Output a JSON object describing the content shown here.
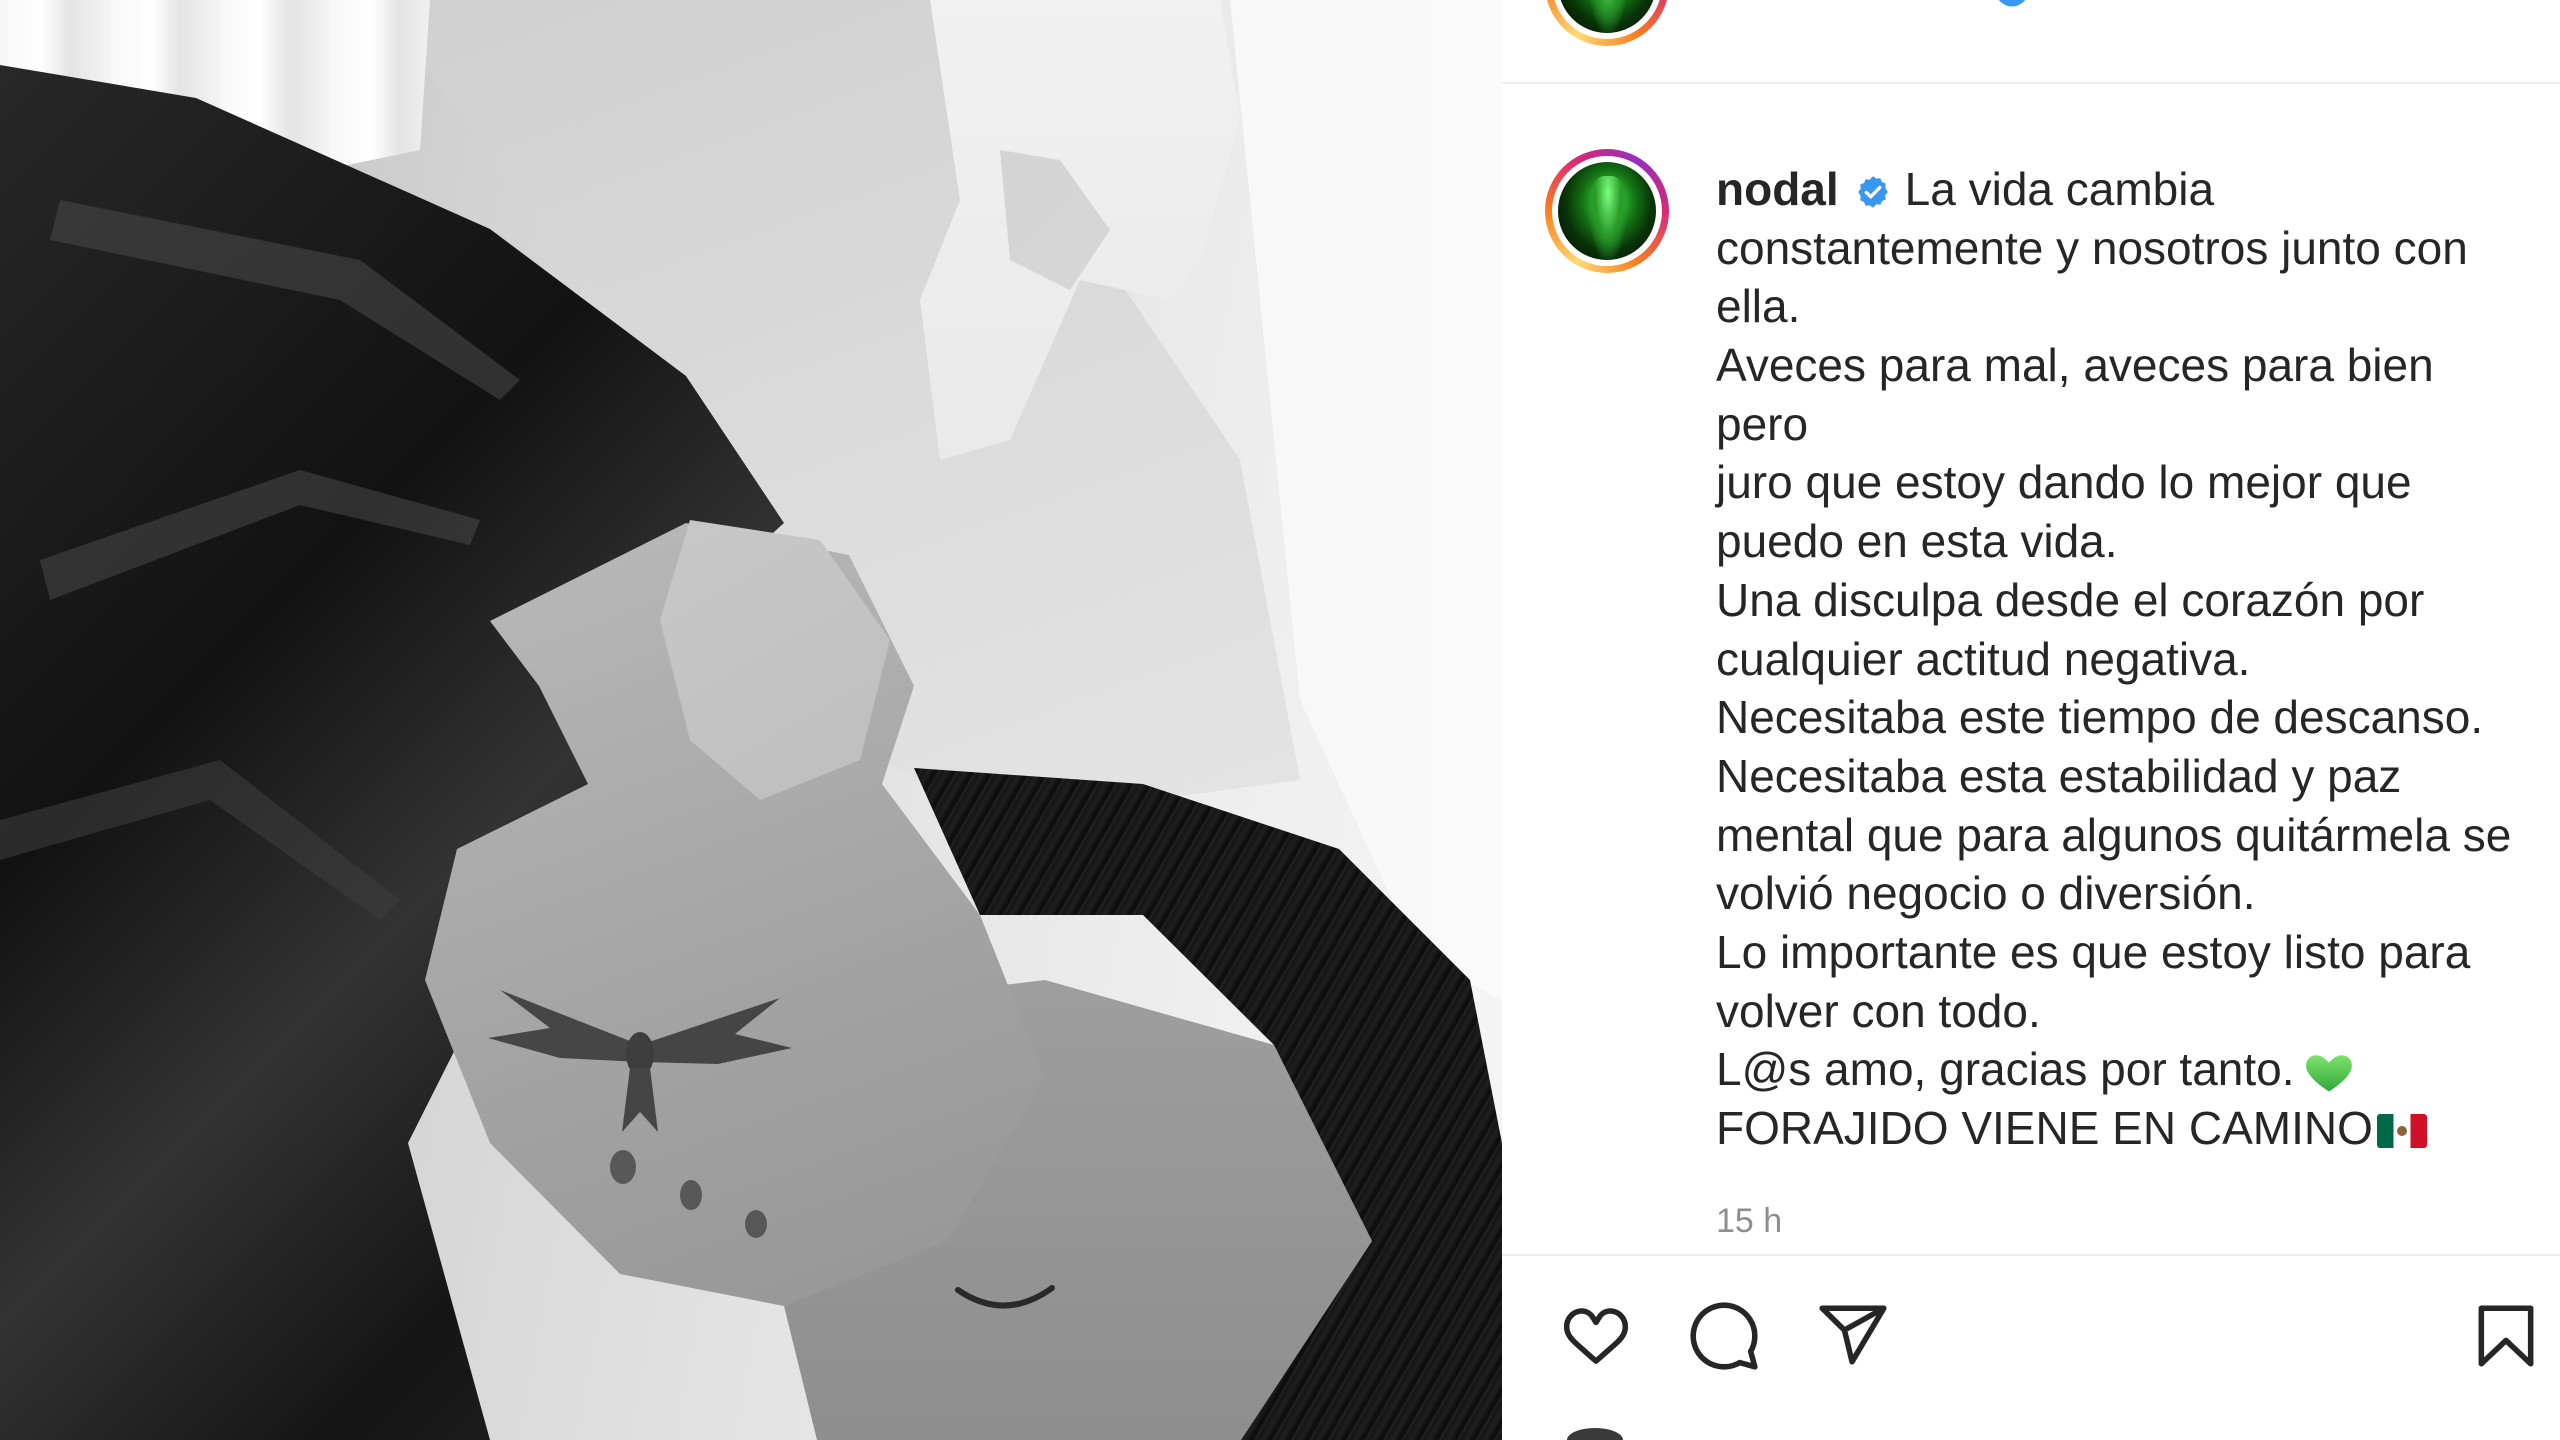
{
  "header": {
    "avatar_icon": "profile-avatar",
    "verified_icon": "verified-badge-icon"
  },
  "caption": {
    "username": "nodal",
    "verified_icon": "verified-badge-icon",
    "first_line": "La vida cambia",
    "lines": [
      "constantemente y nosotros junto con",
      "ella.",
      "Aveces para mal, aveces para bien",
      "pero",
      "juro que estoy dando lo mejor que",
      "puedo en esta vida.",
      "Una disculpa desde el corazón por",
      "cualquier actitud negativa.",
      "Necesitaba este tiempo de descanso.",
      "Necesitaba esta estabilidad y paz",
      "mental que para algunos quitármela se",
      "volvió negocio o diversión.",
      "Lo importante es que estoy listo para",
      "volver con todo.",
      "L@s amo, gracias por tanto.",
      "FORAJIDO VIENE EN CAMINO"
    ],
    "heart_emoji_icon": "green-heart-emoji",
    "flag_emoji_icon": "mexico-flag-emoji",
    "timestamp": "15 h"
  },
  "actions": {
    "like_icon": "heart-icon",
    "comment_icon": "comment-icon",
    "share_icon": "share-icon",
    "save_icon": "bookmark-icon"
  },
  "colors": {
    "text": "#262626",
    "secondary_text": "#8e8e8e",
    "verified_blue": "#3897f0",
    "divider": "#efefef",
    "background": "#ffffff"
  }
}
